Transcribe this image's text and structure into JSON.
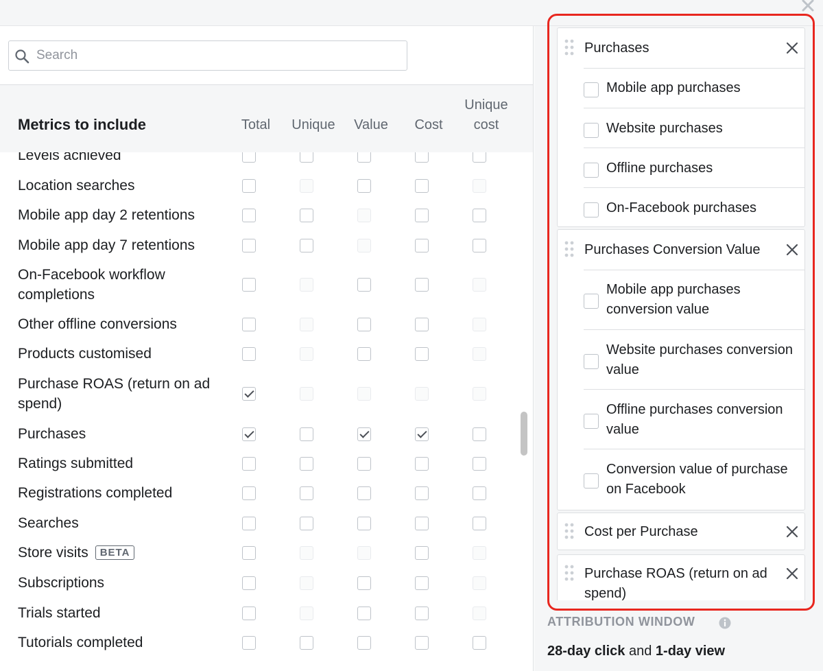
{
  "search": {
    "placeholder": "Search"
  },
  "table": {
    "title": "Metrics to include",
    "columns": [
      "Total",
      "Unique",
      "Value",
      "Cost",
      "Unique cost"
    ],
    "rows": [
      {
        "label": "Levels achieved",
        "states": [
          "off",
          "off",
          "off",
          "off",
          "off"
        ]
      },
      {
        "label": "Location searches",
        "states": [
          "off",
          "dis",
          "off",
          "off",
          "dis"
        ]
      },
      {
        "label": "Mobile app day 2 retentions",
        "states": [
          "off",
          "off",
          "dis",
          "off",
          "off"
        ]
      },
      {
        "label": "Mobile app day 7 retentions",
        "states": [
          "off",
          "off",
          "dis",
          "off",
          "off"
        ]
      },
      {
        "label": "On-Facebook workflow completions",
        "states": [
          "off",
          "dis",
          "off",
          "off",
          "dis"
        ]
      },
      {
        "label": "Other offline conversions",
        "states": [
          "off",
          "dis",
          "off",
          "off",
          "dis"
        ]
      },
      {
        "label": "Products customised",
        "states": [
          "off",
          "dis",
          "off",
          "off",
          "dis"
        ]
      },
      {
        "label": "Purchase ROAS (return on ad spend)",
        "states": [
          "on",
          "dis",
          "dis",
          "dis",
          "dis"
        ]
      },
      {
        "label": "Purchases",
        "states": [
          "on",
          "off",
          "on",
          "on",
          "off"
        ]
      },
      {
        "label": "Ratings submitted",
        "states": [
          "off",
          "off",
          "off",
          "off",
          "off"
        ]
      },
      {
        "label": "Registrations completed",
        "states": [
          "off",
          "off",
          "off",
          "off",
          "off"
        ]
      },
      {
        "label": "Searches",
        "states": [
          "off",
          "off",
          "off",
          "off",
          "off"
        ]
      },
      {
        "label": "Store visits",
        "badge": "BETA",
        "states": [
          "off",
          "dis",
          "dis",
          "off",
          "dis"
        ]
      },
      {
        "label": "Subscriptions",
        "states": [
          "off",
          "dis",
          "off",
          "off",
          "dis"
        ]
      },
      {
        "label": "Trials started",
        "states": [
          "off",
          "dis",
          "off",
          "off",
          "dis"
        ]
      },
      {
        "label": "Tutorials completed",
        "states": [
          "off",
          "off",
          "off",
          "off",
          "off"
        ]
      }
    ]
  },
  "selected": [
    {
      "title": "Purchases",
      "items": [
        "Mobile app purchases",
        "Website purchases",
        "Offline purchases",
        "On-Facebook purchases"
      ]
    },
    {
      "title": "Purchases Conversion Value",
      "items": [
        "Mobile app purchases conversion value",
        "Website purchases conversion value",
        "Offline purchases conversion value",
        "Conversion value of purchase on Facebook"
      ]
    },
    {
      "title": "Cost per Purchase",
      "items": []
    },
    {
      "title": "Purchase ROAS (return on ad spend)",
      "items": []
    }
  ],
  "attribution": {
    "title": "ATTRIBUTION WINDOW",
    "click": "28-day click",
    "joiner": " and ",
    "view": "1-day view"
  },
  "colors": {
    "highlight": "#e8271f",
    "panel_bg": "#f5f6f7",
    "border": "#dddfe2"
  },
  "icons": {
    "close": "close-icon",
    "search": "search-icon",
    "drag": "drag-handle-icon",
    "remove": "remove-icon",
    "info": "info-icon"
  }
}
